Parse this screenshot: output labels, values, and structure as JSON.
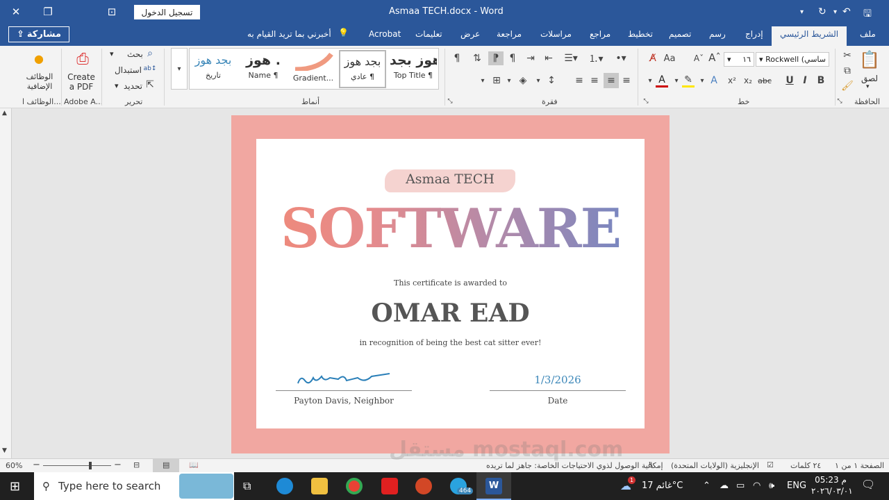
{
  "titlebar": {
    "doc_title": "Asmaa TECH.docx  -  Word",
    "signin_label": "تسجيل الدخول"
  },
  "tabs": {
    "share": "مشاركة",
    "file": "ملف",
    "home": "الشريط الرئيسي",
    "insert": "إدراج",
    "draw": "رسم",
    "design": "تصميم",
    "layout": "تخطيط",
    "references": "مراجع",
    "mailings": "مراسلات",
    "review": "مراجعة",
    "view": "عرض",
    "help": "تعليمات",
    "acrobat": "Acrobat",
    "tell_me": "أخبرني بما تريد القيام به"
  },
  "ribbon": {
    "clipboard_label": "الحافظة",
    "paste_label": "لصق",
    "font_label": "خط",
    "font_name": "Rockwell (ساسي",
    "font_size": "١٦",
    "paragraph_label": "فقرة",
    "styles_label": "أنماط",
    "editing_label": "تحرير",
    "find": "بحث",
    "replace": "استبدال",
    "select": "تحديد",
    "adobe_label": "Adobe A...",
    "create_pdf": "Create a PDF",
    "addins_label": "الوظائف ا...",
    "addins_button": "الوظائف الإضافية",
    "styles": [
      {
        "sample": "هوز بجد",
        "name": "Top Title ¶"
      },
      {
        "sample": "بجد هوز",
        "name": "عادي ¶"
      },
      {
        "sample": "",
        "name": "Gradient..."
      },
      {
        "sample": "هوز .",
        "name": "Name ¶"
      },
      {
        "sample": "بجد هوز",
        "name": "تاريخ"
      }
    ]
  },
  "document": {
    "company": "Asmaa TECH",
    "headline": "SOFTWARE",
    "awarded_text": "This certificate is awarded to",
    "recipient": "OMAR EAD",
    "reason": "in recognition of being the best cat sitter ever!",
    "signer": "Payton Davis, Neighbor",
    "date_value": "1/3/2026",
    "date_label": "Date"
  },
  "statusbar": {
    "page": "الصفحة ١ من ١",
    "words": "٢٤ كلمات",
    "language": "الإنجليزية (الولايات المتحدة)",
    "accessibility": "إمكانية الوصول لذوي الاحتياجات الخاصة: جاهز لما تريده",
    "zoom": "60%",
    "zoom_level": 0.6
  },
  "taskbar": {
    "search_placeholder": "Type here to search",
    "weather": "غائم  17°C",
    "lang": "ENG",
    "time": "م 05:23",
    "date": "٢٠٢٦/٠٣/٠١",
    "telegram_badge": "464",
    "weather_badge": "1"
  },
  "watermark": "مستقل mostaql.com",
  "colors": {
    "word_blue": "#2b579a",
    "frame_pink": "#f1a7a1",
    "date_blue": "#3a86b8"
  }
}
